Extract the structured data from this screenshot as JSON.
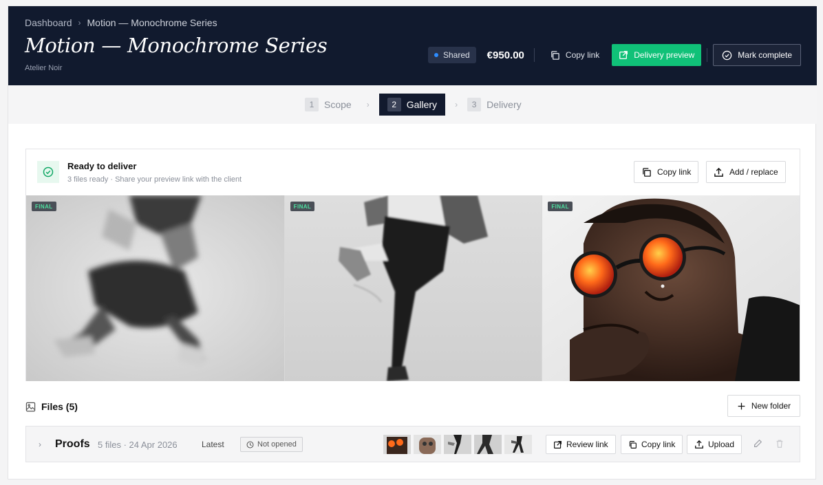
{
  "breadcrumb": {
    "root": "Dashboard",
    "separator": "›",
    "current": "Motion — Monochrome Series"
  },
  "page": {
    "title": "Motion — Monochrome Series",
    "client": "Atelier Noir"
  },
  "header_actions": {
    "status": "Shared",
    "price": "€950.00",
    "copy_link": "Copy link",
    "delivery_preview": "Delivery preview",
    "mark_complete": "Mark complete"
  },
  "steps": [
    {
      "num": "1",
      "label": "Scope",
      "active": false
    },
    {
      "num": "2",
      "label": "Gallery",
      "active": true
    },
    {
      "num": "3",
      "label": "Delivery",
      "active": false
    }
  ],
  "ready": {
    "title": "Ready to deliver",
    "subtitle": "3 files ready · Share your preview link with the client",
    "copy_link": "Copy link",
    "add_replace": "Add / replace"
  },
  "gallery": [
    {
      "tag": "FINAL",
      "subject": "dancer-jumping-blur"
    },
    {
      "tag": "FINAL",
      "subject": "dancer-kicking"
    },
    {
      "tag": "FINAL",
      "subject": "man-orange-sunglasses"
    }
  ],
  "files": {
    "heading": "Files (5)",
    "new_folder": "New folder"
  },
  "folder": {
    "name": "Proofs",
    "meta": "5 files · 24 Apr 2026",
    "latest": "Latest",
    "status": "Not opened",
    "review_link": "Review link",
    "copy_link": "Copy link",
    "upload": "Upload"
  },
  "colors": {
    "header_bg": "#111a2e",
    "accent_green": "#10c178",
    "status_dot": "#2d8cff"
  }
}
